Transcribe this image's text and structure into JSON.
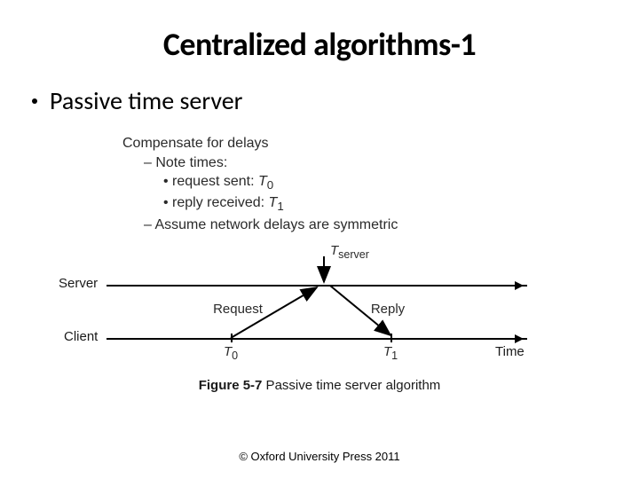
{
  "title": "Centralized algorithms-1",
  "bullet": "Passive time server",
  "figure_text": {
    "comp": "Compensate for delays",
    "note": "Note times:",
    "req_sent_prefix": "request sent: ",
    "req_sent_var": "T",
    "req_sent_sub": "0",
    "rep_recv_prefix": "reply received: ",
    "rep_recv_var": "T",
    "rep_recv_sub": "1",
    "assume": "Assume network delays are symmetric"
  },
  "diagram": {
    "server_label": "Server",
    "client_label": "Client",
    "request_label": "Request",
    "reply_label": "Reply",
    "time_label": "Time",
    "tserver": "T",
    "tserver_sub": "server",
    "t0": "T",
    "t0_sub": "0",
    "t1": "T",
    "t1_sub": "1"
  },
  "caption_bold": "Figure 5-7",
  "caption_rest": "  Passive time server algorithm",
  "copyright": "© Oxford University Press 2011"
}
